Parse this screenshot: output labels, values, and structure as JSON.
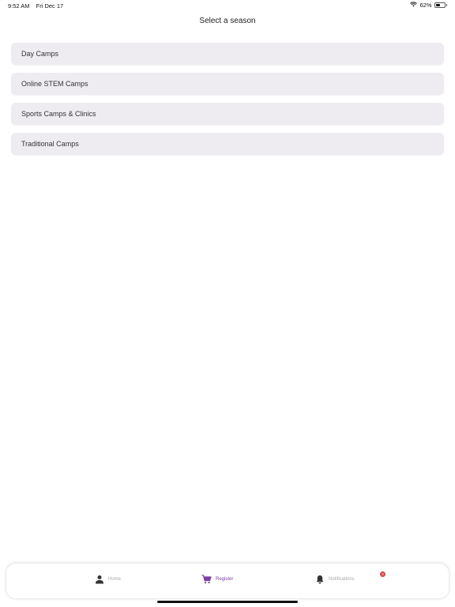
{
  "status_bar": {
    "time": "9:52 AM",
    "date": "Fri Dec 17",
    "battery": "62%",
    "battery_level": 0.62
  },
  "page": {
    "title": "Select a season"
  },
  "seasons": [
    {
      "label": "Day Camps"
    },
    {
      "label": "Online STEM Camps"
    },
    {
      "label": "Sports Camps & Clinics"
    },
    {
      "label": "Traditional Camps"
    }
  ],
  "tab_bar": {
    "home": {
      "label": "Home",
      "icon": "person-icon"
    },
    "register": {
      "label": "Register",
      "icon": "cart-icon",
      "active": true
    },
    "notifications": {
      "label": "Notifications",
      "icon": "bell-icon",
      "badge": "0"
    }
  },
  "colors": {
    "accent": "#7b3fa0",
    "item_background": "#efecf1",
    "badge": "#d64545"
  }
}
